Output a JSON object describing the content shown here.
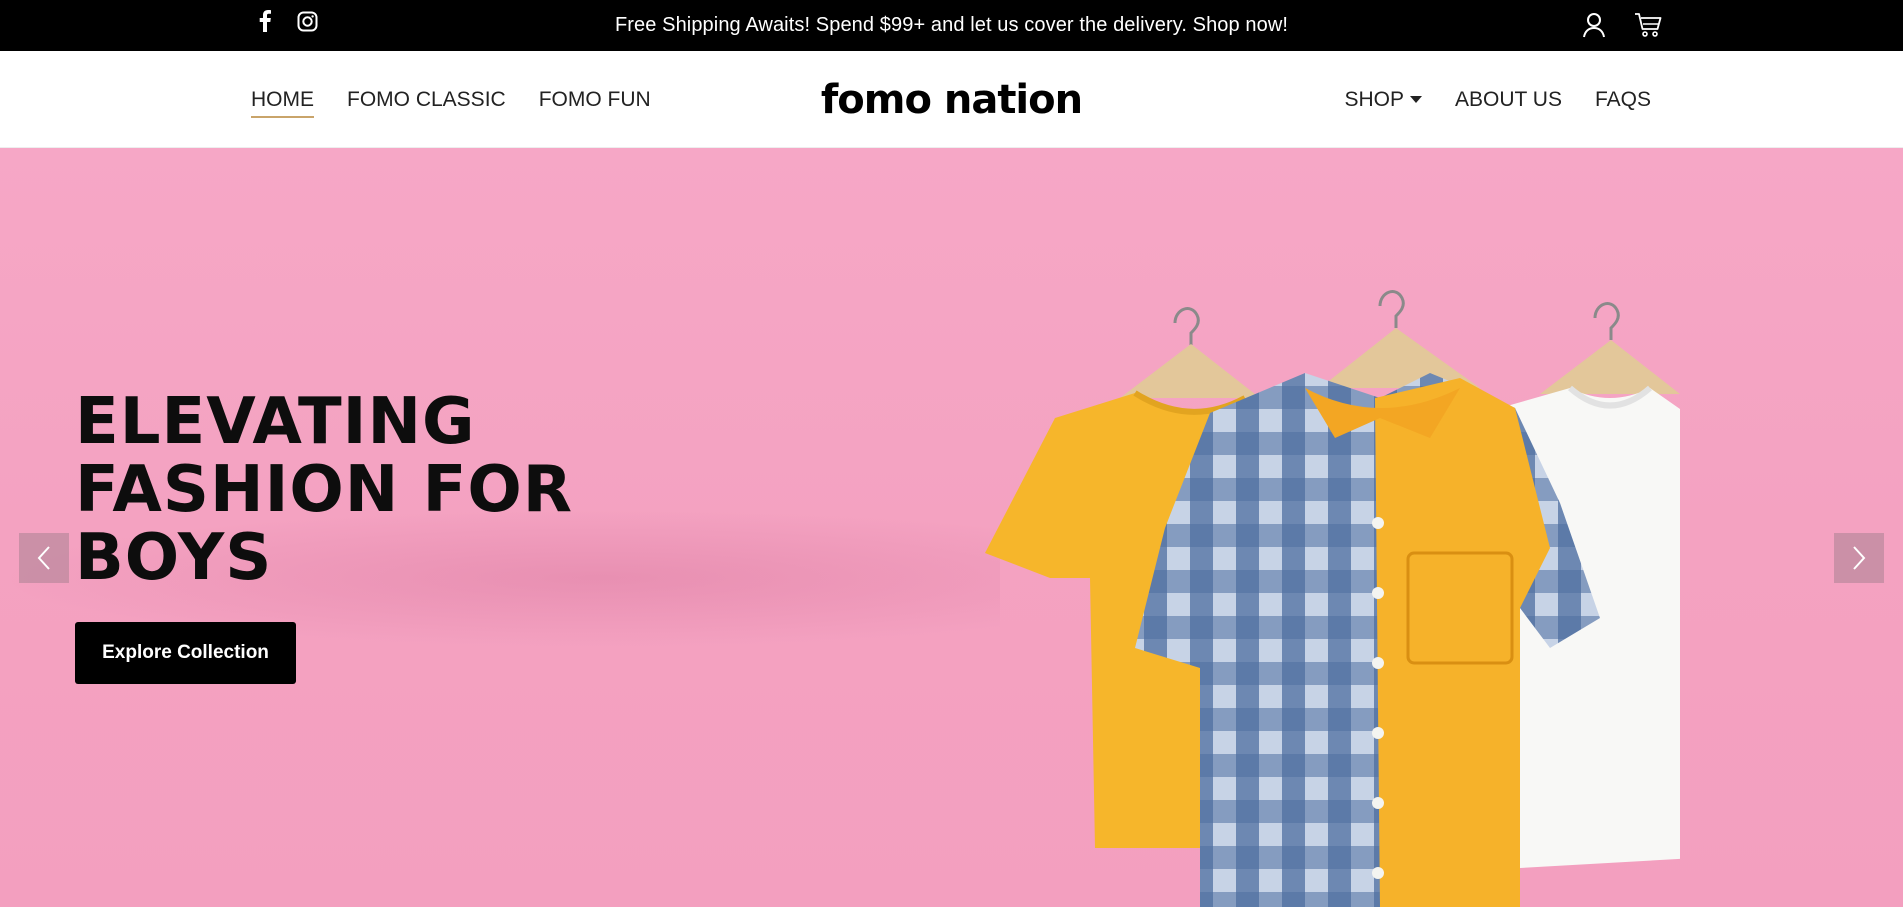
{
  "topbar": {
    "announcement": "Free Shipping Awaits! Spend $99+ and let us cover the delivery. Shop now!",
    "social_icons": [
      "facebook-icon",
      "instagram-icon"
    ],
    "util_icons": [
      "user-icon",
      "cart-icon"
    ]
  },
  "nav": {
    "left_items": [
      {
        "label": "HOME",
        "active": true
      },
      {
        "label": "FOMO CLASSIC"
      },
      {
        "label": "FOMO FUN"
      }
    ],
    "logo": "fomo nation",
    "right_items": [
      {
        "label": "SHOP",
        "has_dropdown": true
      },
      {
        "label": "ABOUT US"
      },
      {
        "label": "FAQS"
      }
    ]
  },
  "hero": {
    "headline_lines": [
      "ELEVATING",
      "FASHION FOR",
      "BOYS"
    ],
    "cta_label": "Explore Collection",
    "prev_icon": "chevron-left-icon",
    "next_icon": "chevron-right-icon",
    "background_color": "#f6a7c6"
  },
  "colors": {
    "topbar_bg": "#000000",
    "active_underline": "#c9a46a",
    "cta_bg": "#000000"
  }
}
